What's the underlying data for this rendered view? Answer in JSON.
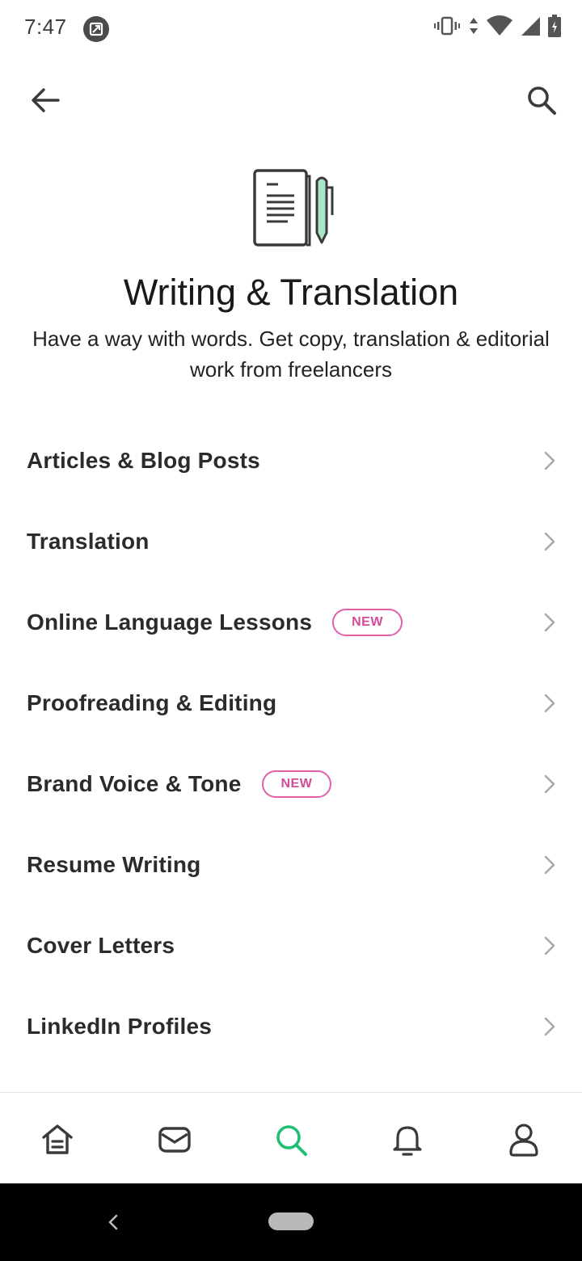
{
  "status_bar": {
    "time": "7:47"
  },
  "header": {
    "back_icon": "arrow-left-icon",
    "search_icon": "search-icon"
  },
  "hero": {
    "icon": "document-pen-icon",
    "title": "Writing & Translation",
    "subtitle": "Have a way with words. Get copy, translation & editorial work from freelancers"
  },
  "subcategories": [
    {
      "label": "Articles & Blog Posts",
      "badge": ""
    },
    {
      "label": "Translation",
      "badge": ""
    },
    {
      "label": "Online Language Lessons",
      "badge": "NEW"
    },
    {
      "label": "Proofreading & Editing",
      "badge": ""
    },
    {
      "label": "Brand Voice & Tone",
      "badge": "NEW"
    },
    {
      "label": "Resume Writing",
      "badge": ""
    },
    {
      "label": "Cover Letters",
      "badge": ""
    },
    {
      "label": "LinkedIn Profiles",
      "badge": ""
    }
  ],
  "bottom_nav": [
    {
      "icon": "home-icon",
      "active": false
    },
    {
      "icon": "inbox-icon",
      "active": false
    },
    {
      "icon": "search-icon",
      "active": true
    },
    {
      "icon": "bell-icon",
      "active": false
    },
    {
      "icon": "profile-icon",
      "active": false
    }
  ],
  "colors": {
    "accent_green": "#1dbf73",
    "badge_pink": "#e25fa9",
    "pen_green": "#a8e6c8"
  }
}
